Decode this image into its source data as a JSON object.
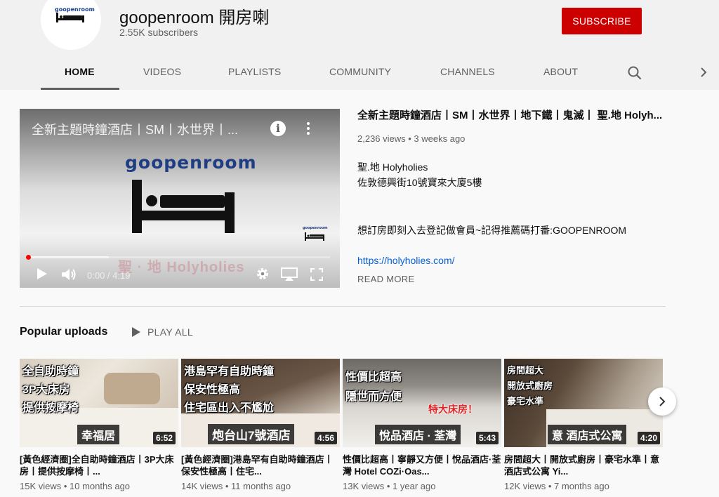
{
  "channel": {
    "logo_text": "goopenroom",
    "name": "goopenroom 開房喇",
    "subscribers": "2.55K subscribers",
    "subscribe_label": "SUBSCRIBE"
  },
  "tabs": [
    {
      "label": "HOME",
      "active": true
    },
    {
      "label": "VIDEOS"
    },
    {
      "label": "PLAYLISTS"
    },
    {
      "label": "COMMUNITY"
    },
    {
      "label": "CHANNELS"
    },
    {
      "label": "ABOUT"
    }
  ],
  "featured": {
    "overlay_title": "全新主題時鐘酒店丨SM丨水世界丨...",
    "logo_text": "goopenroom",
    "watermark_logo": "goopenroom",
    "watermark_text": "聖 · 地 Holyholies",
    "time": "0:00 / 4:19",
    "progress": 0,
    "title": "全新主題時鐘酒店丨SM丨水世界丨地下鐵丨鬼滅丨 聖.地 Holyh...",
    "meta": "2,236 views • 3 weeks ago",
    "description": [
      "聖.地 Holyholies",
      "佐敦德興街10號寶來大廈5樓",
      "想訂房即刻入去登記做會員~記得推薦碼打番:GOOPENROOM"
    ],
    "link": "https://holyholies.com/",
    "read_more": "READ MORE"
  },
  "shelf": {
    "title": "Popular uploads",
    "play_all": "PLAY ALL",
    "items": [
      {
        "thumb_lines": [
          "全自助時鐘",
          "3P大床房",
          "提供按摩椅"
        ],
        "banner": "幸福居",
        "duration": "6:52",
        "title": "[黃色經濟圈]全自助時鐘酒店丨3P大床房丨提供按摩椅丨...",
        "meta": "15K views • 10 months ago"
      },
      {
        "thumb_lines": [
          "港島罕有自助時鐘",
          "保安性極高",
          "住宅區出入不尷尬"
        ],
        "banner": "炮台山7號酒店",
        "duration": "4:56",
        "title": "[黃色經濟圈]港島罕有自助時鐘酒店丨保安性極高丨住宅...",
        "meta": "14K views • 11 months ago"
      },
      {
        "thumb_lines": [
          "性價比超高",
          "隱世而方便"
        ],
        "red_text": "特大床房！",
        "banner": "悅品酒店 · 荃灣",
        "duration": "5:43",
        "title": "性價比超高丨寧靜又方便丨悅品酒店·荃灣 Hotel COZi·Oas...",
        "meta": "13K views • 1 year ago"
      },
      {
        "thumb_lines": [
          "房間超大",
          "開放式廚房",
          "豪宅水準"
        ],
        "banner": "意 酒店式公寓",
        "duration": "4:20",
        "title": "房間超大丨開放式廚房丨豪宅水準丨意 酒店式公寓 Yi...",
        "meta": "12K views • 7 months ago"
      }
    ]
  }
}
